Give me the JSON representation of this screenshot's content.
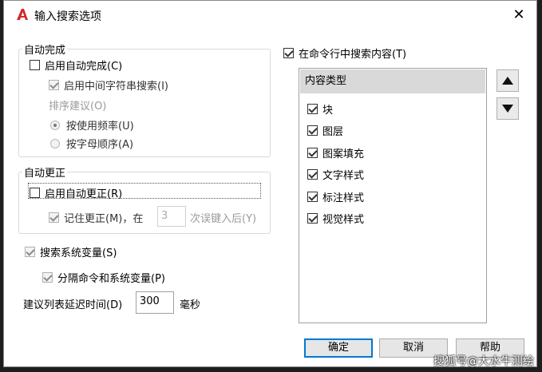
{
  "title": "输入搜索选项",
  "close": "✕",
  "auto_complete": {
    "group_label": "自动完成",
    "enable": {
      "label": "启用自动完成(C)",
      "checked": false
    },
    "mid_string": {
      "label": "启用中间字符串搜索(I)",
      "checked": true
    },
    "sort_label": "排序建议(O)",
    "by_frequency": {
      "label": "按使用频率(U)",
      "selected": true
    },
    "alphabetical": {
      "label": "按字母顺序(A)",
      "selected": false
    }
  },
  "auto_correct": {
    "group_label": "自动更正",
    "enable": {
      "label": "启用自动更正(R)",
      "checked": false
    },
    "remember_prefix": "记住更正(M)，在",
    "remember_count": "3",
    "remember_suffix": "次误键入后(Y)"
  },
  "system_vars": {
    "label": "搜索系统变量(S)",
    "checked": true
  },
  "separate_cmds": {
    "label": "分隔命令和系统变量(P)",
    "checked": true
  },
  "delay": {
    "label": "建议列表延迟时间(D)",
    "value": "300",
    "unit": "毫秒"
  },
  "search_content": {
    "label": "在命令行中搜索内容(T)",
    "checked": true
  },
  "content_types": {
    "header": "内容类型",
    "items": [
      {
        "label": "块",
        "checked": true
      },
      {
        "label": "图层",
        "checked": true
      },
      {
        "label": "图案填充",
        "checked": true
      },
      {
        "label": "文字样式",
        "checked": true
      },
      {
        "label": "标注样式",
        "checked": true
      },
      {
        "label": "视觉样式",
        "checked": true
      }
    ]
  },
  "buttons": {
    "ok": "确定",
    "cancel": "取消",
    "help": "帮助"
  },
  "watermark": "搜狐号@大水牛测绘",
  "colors": {
    "accent": "#0078d7",
    "app_icon": "#d12b2b"
  }
}
